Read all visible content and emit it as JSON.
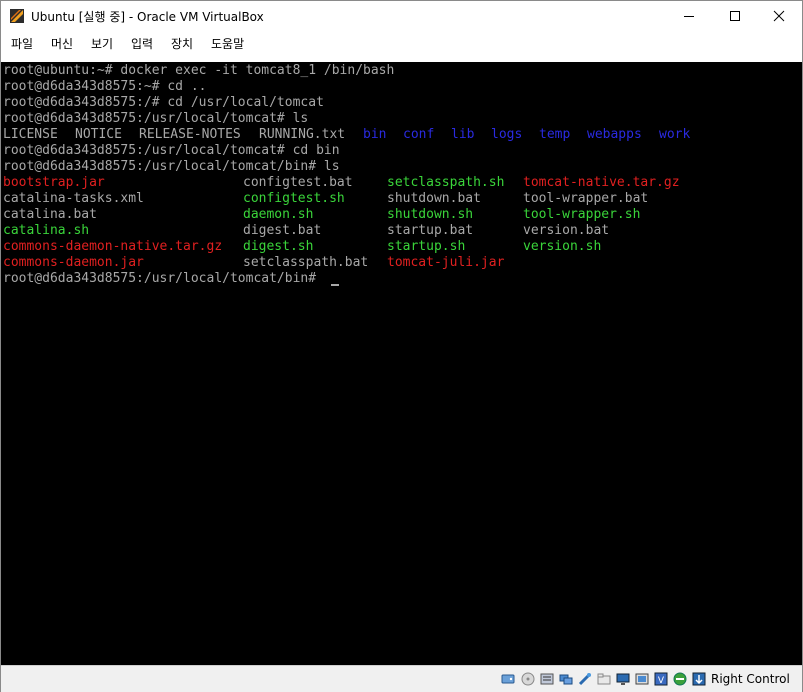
{
  "window": {
    "title": "Ubuntu [실행 중] - Oracle VM VirtualBox"
  },
  "menu": [
    "파일",
    "머신",
    "보기",
    "입력",
    "장치",
    "도움말"
  ],
  "colors": {
    "text": "#a8a8a8",
    "dir": "#2a2ae0",
    "exec": "#3ad43a",
    "archive": "#e02020",
    "cursor": "#a8a8a8"
  },
  "terminal": {
    "lines": [
      [
        {
          "t": "root@ubuntu:~# docker exec -it tomcat8_1 /bin/bash"
        }
      ],
      [
        {
          "t": "root@d6da343d8575:~# cd .."
        }
      ],
      [
        {
          "t": "root@d6da343d8575:/# cd /usr/local/tomcat"
        }
      ],
      [
        {
          "t": "root@d6da343d8575:/usr/local/tomcat# ls"
        }
      ],
      [
        {
          "t": "LICENSE"
        },
        {
          "t": "NOTICE",
          "col": 9
        },
        {
          "t": "RELEASE-NOTES",
          "col": 17
        },
        {
          "t": "RUNNING.txt",
          "col": 32
        },
        {
          "t": "bin",
          "col": 45,
          "c": "dir"
        },
        {
          "t": "conf",
          "col": 50,
          "c": "dir"
        },
        {
          "t": "lib",
          "col": 56,
          "c": "dir"
        },
        {
          "t": "logs",
          "col": 61,
          "c": "dir"
        },
        {
          "t": "temp",
          "col": 67,
          "c": "dir"
        },
        {
          "t": "webapps",
          "col": 73,
          "c": "dir"
        },
        {
          "t": "work",
          "col": 82,
          "c": "dir"
        }
      ],
      [
        {
          "t": "root@d6da343d8575:/usr/local/tomcat# cd bin"
        }
      ],
      [
        {
          "t": "root@d6da343d8575:/usr/local/tomcat/bin# ls"
        }
      ],
      [
        {
          "t": "bootstrap.jar",
          "c": "archive"
        },
        {
          "t": "configtest.bat",
          "col": 30
        },
        {
          "t": "setclasspath.sh",
          "col": 48,
          "c": "exec"
        },
        {
          "t": "tomcat-native.tar.gz",
          "col": 65,
          "c": "archive"
        }
      ],
      [
        {
          "t": "catalina-tasks.xml"
        },
        {
          "t": "configtest.sh",
          "col": 30,
          "c": "exec"
        },
        {
          "t": "shutdown.bat",
          "col": 48
        },
        {
          "t": "tool-wrapper.bat",
          "col": 65
        }
      ],
      [
        {
          "t": "catalina.bat"
        },
        {
          "t": "daemon.sh",
          "col": 30,
          "c": "exec"
        },
        {
          "t": "shutdown.sh",
          "col": 48,
          "c": "exec"
        },
        {
          "t": "tool-wrapper.sh",
          "col": 65,
          "c": "exec"
        }
      ],
      [
        {
          "t": "catalina.sh",
          "c": "exec"
        },
        {
          "t": "digest.bat",
          "col": 30
        },
        {
          "t": "startup.bat",
          "col": 48
        },
        {
          "t": "version.bat",
          "col": 65
        }
      ],
      [
        {
          "t": "commons-daemon-native.tar.gz",
          "c": "archive"
        },
        {
          "t": "digest.sh",
          "col": 30,
          "c": "exec"
        },
        {
          "t": "startup.sh",
          "col": 48,
          "c": "exec"
        },
        {
          "t": "version.sh",
          "col": 65,
          "c": "exec"
        }
      ],
      [
        {
          "t": "commons-daemon.jar",
          "c": "archive"
        },
        {
          "t": "setclasspath.bat",
          "col": 30
        },
        {
          "t": "tomcat-juli.jar",
          "col": 48,
          "c": "archive"
        }
      ],
      [
        {
          "t": "root@d6da343d8575:/usr/local/tomcat/bin# "
        }
      ]
    ]
  },
  "status": {
    "icons": [
      "hard-disk-icon",
      "optical-drive-icon",
      "audio-icon",
      "network-icon",
      "usb-icon",
      "shared-folders-icon",
      "display-icon",
      "video-capture-icon",
      "cpu-icon",
      "virtualization-icon",
      "mouse-integration-icon",
      "host-key-arrow-icon"
    ],
    "host_key": "Right Control"
  }
}
